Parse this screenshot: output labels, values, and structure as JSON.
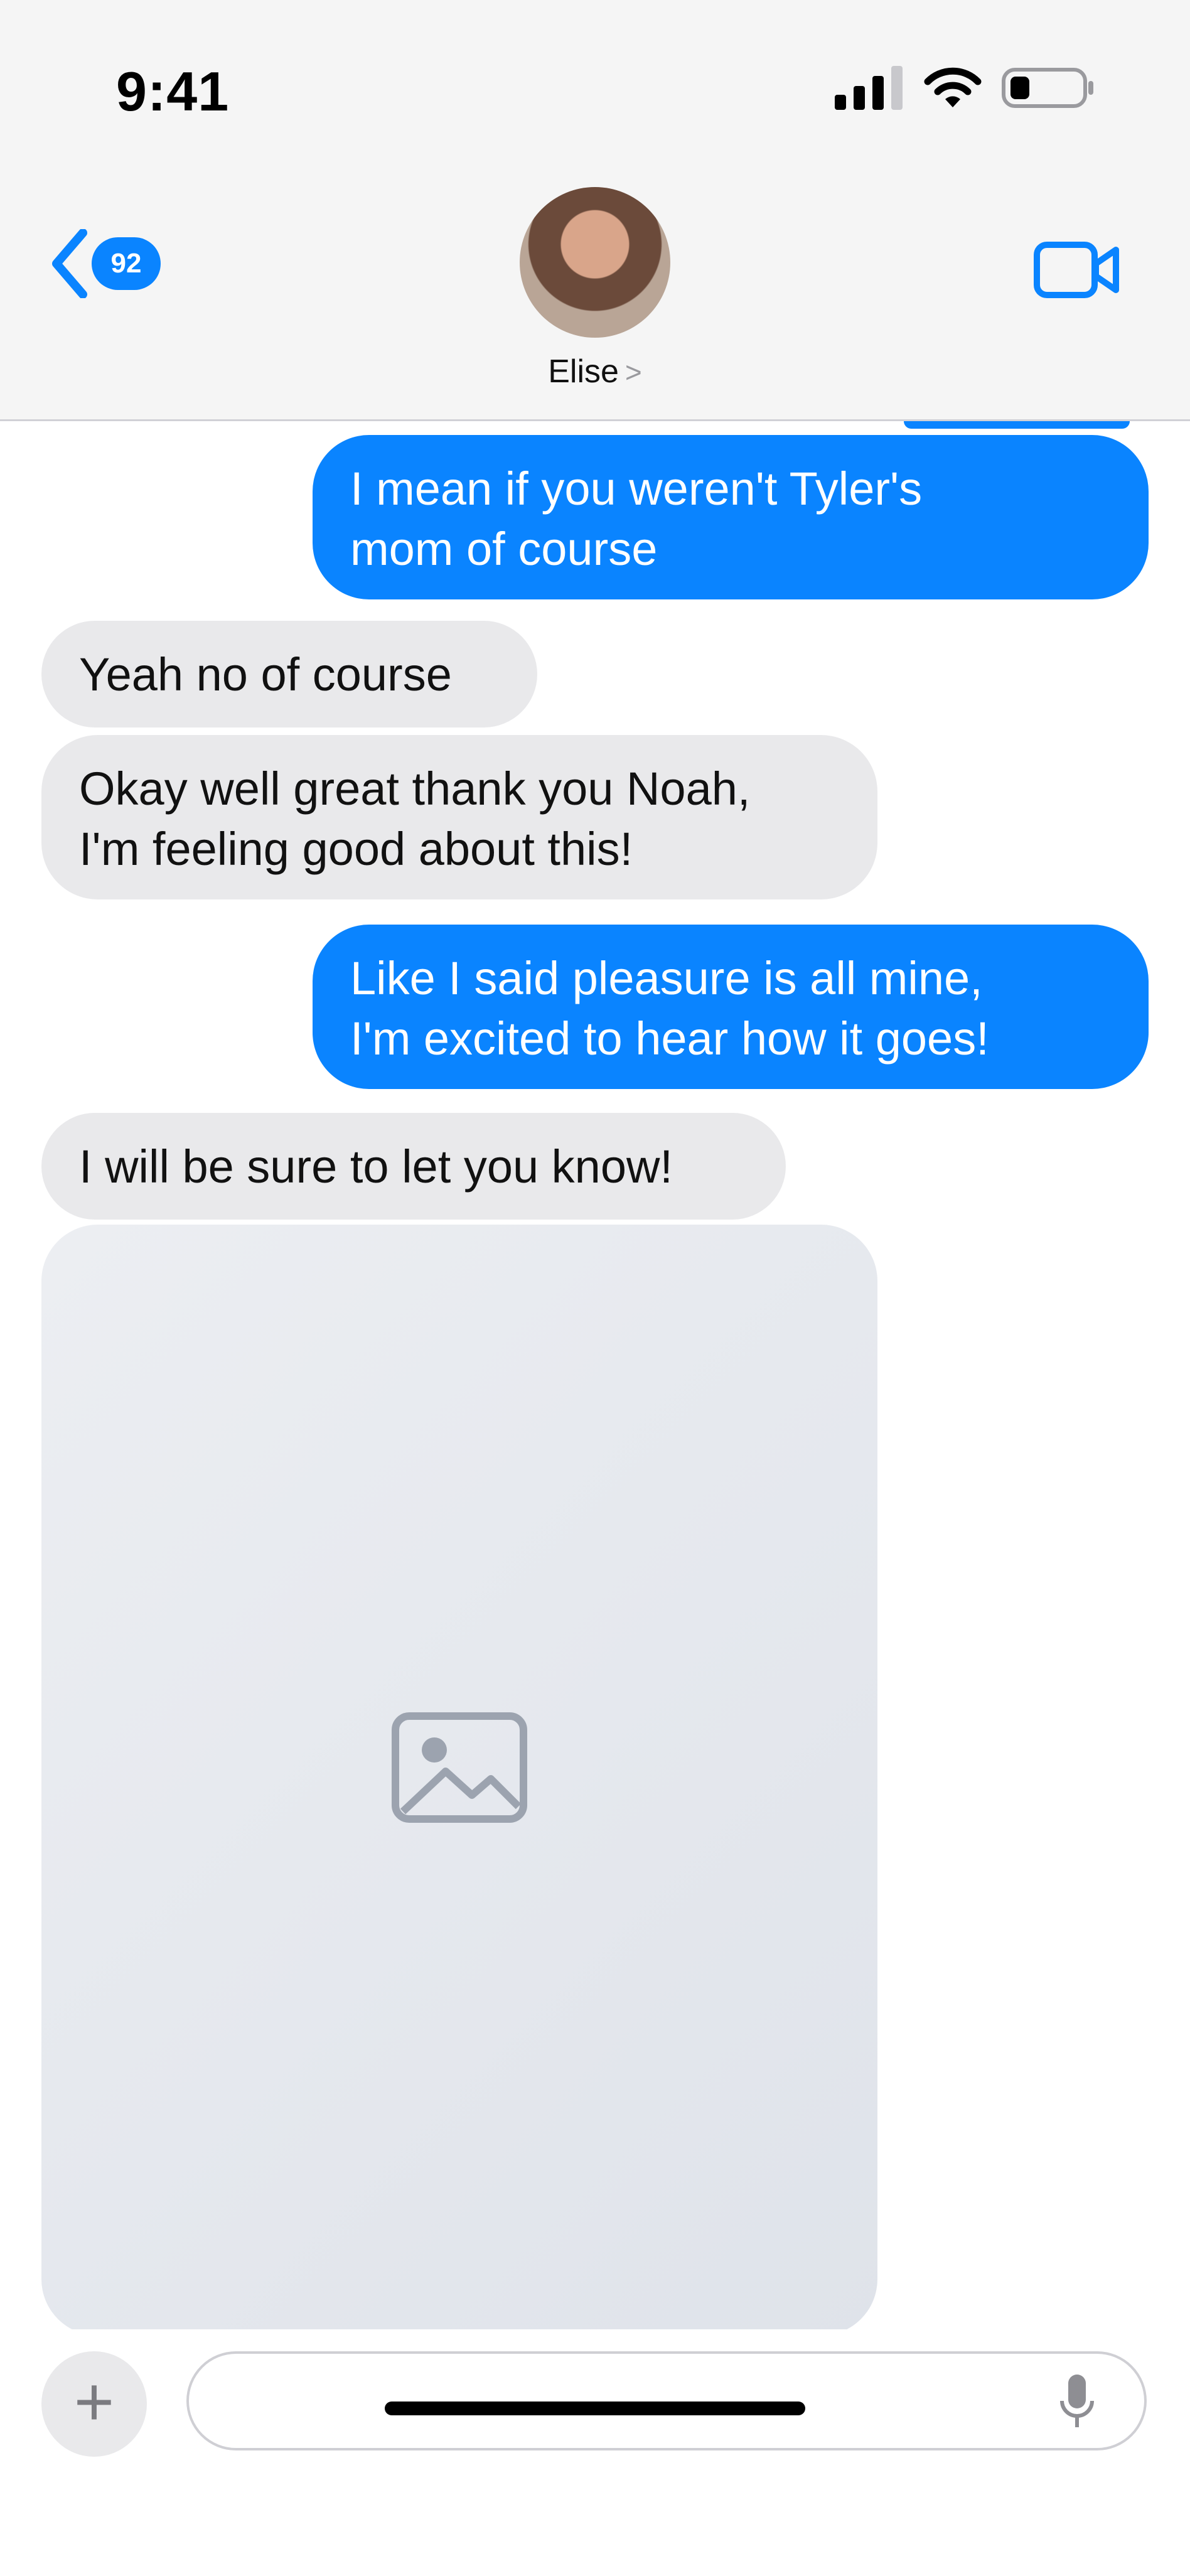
{
  "status_bar": {
    "time": "9:41"
  },
  "header": {
    "back_badge": "92",
    "contact_name": "Elise",
    "contact_chevron": ">"
  },
  "messages": [
    {
      "from": "me",
      "text_line1": "I mean if you weren't Tyler's",
      "text_line2": "mom of course"
    },
    {
      "from": "them",
      "text_line1": "Yeah no of course"
    },
    {
      "from": "them",
      "text_line1": "Okay well great thank you Noah,",
      "text_line2": "I'm feeling good about this!"
    },
    {
      "from": "me",
      "text_line1": "Like I said pleasure is all mine,",
      "text_line2": "I'm excited to hear how it goes!"
    },
    {
      "from": "them",
      "text_line1": "I will be sure to let you know!"
    }
  ],
  "photo": {
    "placeholder_label": ""
  },
  "colors": {
    "outgoing": "#0a84ff",
    "incoming": "#e9e9eb",
    "chrome": "#f5f5f5"
  },
  "composer": {
    "placeholder": ""
  }
}
